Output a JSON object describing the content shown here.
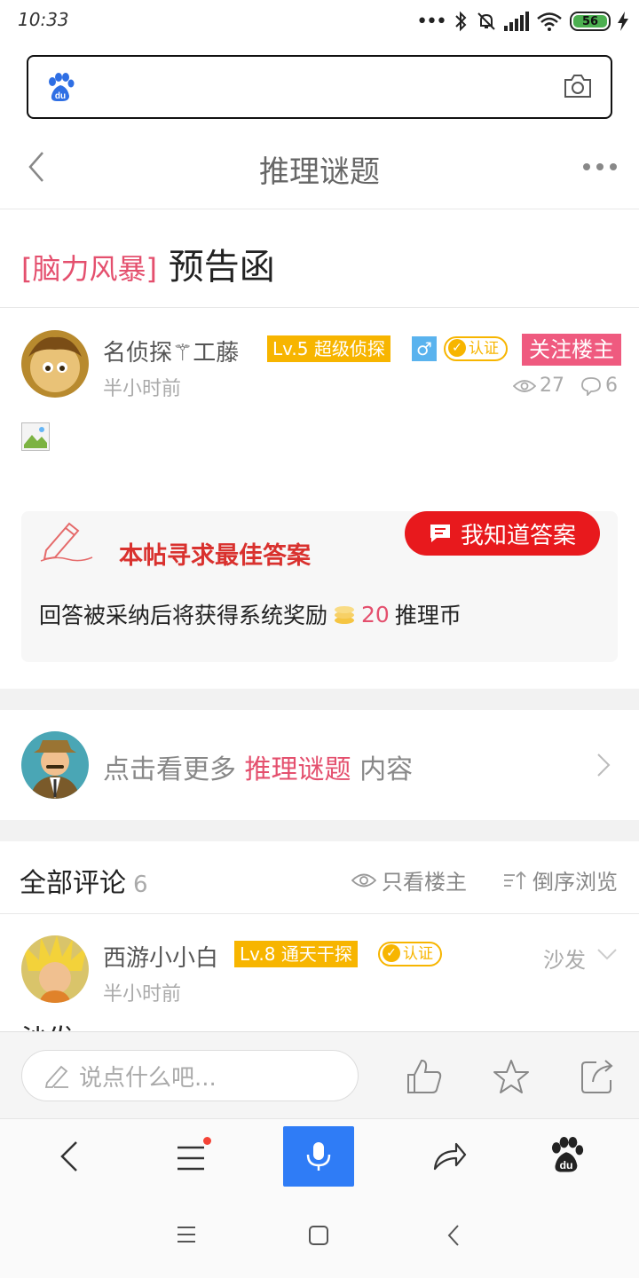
{
  "status_bar": {
    "time": "10:33",
    "battery": "56"
  },
  "header": {
    "title": "推理谜题"
  },
  "post": {
    "tag": "[脑力风暴]",
    "title": "预告函",
    "author": {
      "name": "名侦探⚚工藤",
      "level": "Lv.5 超级侦探",
      "gender": "♂",
      "verified": "认证",
      "follow": "关注楼主",
      "time": "半小时前",
      "views": "27",
      "comments": "6"
    }
  },
  "reward": {
    "heading": "本帖寻求最佳答案",
    "button": "我知道答案",
    "text": "回答被采纳后将获得系统奖励",
    "amount": "20",
    "unit": "推理币"
  },
  "more": {
    "prefix": "点击看更多",
    "topic": "推理谜题",
    "suffix": "内容"
  },
  "comments": {
    "title": "全部评论",
    "count": "6",
    "only_op": "只看楼主",
    "reverse": "倒序浏览",
    "items": [
      {
        "name": "西游小小白",
        "level": "Lv.8 通天干探",
        "verified": "认证",
        "floor": "沙发",
        "time": "半小时前",
        "text": "沙发"
      }
    ]
  },
  "reply": {
    "placeholder": "说点什么吧..."
  },
  "colors": {
    "accent_pink": "#e4506e",
    "reward_red": "#e8191d",
    "level_gold": "#f7b500",
    "voice_blue": "#2f7cf6"
  }
}
